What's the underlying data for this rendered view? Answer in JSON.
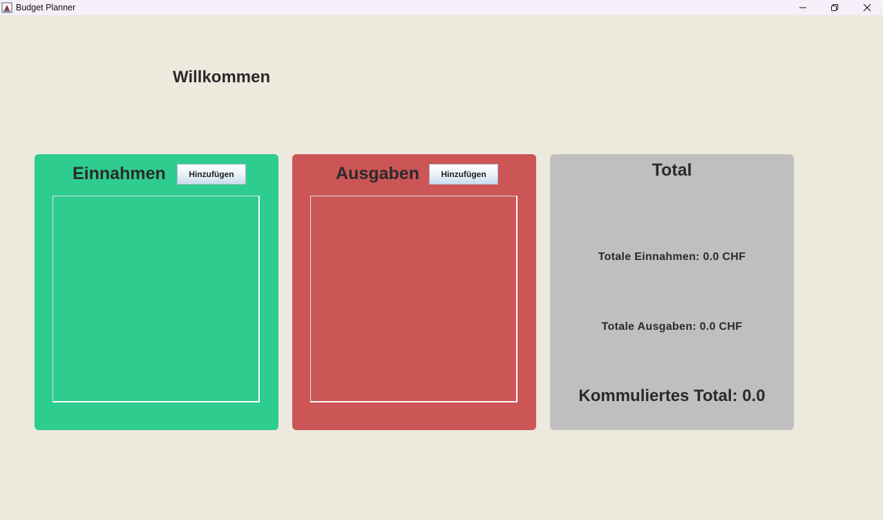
{
  "window": {
    "title": "Budget Planner",
    "icon": "java-coffee-icon"
  },
  "main": {
    "welcome": "Willkommen"
  },
  "income_panel": {
    "title": "Einnahmen",
    "add_label": "Hinzufügen",
    "items": [],
    "color": "#2ecc8f"
  },
  "expense_panel": {
    "title": "Ausgaben",
    "add_label": "Hinzufügen",
    "items": [],
    "color": "#cc5555"
  },
  "total_panel": {
    "title": "Total",
    "total_income": "Totale Einnahmen: 0.0 CHF",
    "total_expense": "Totale Ausgaben: 0.0 CHF",
    "cumulative": "Kommuliertes Total: 0.0",
    "color": "#bfbfbf"
  }
}
